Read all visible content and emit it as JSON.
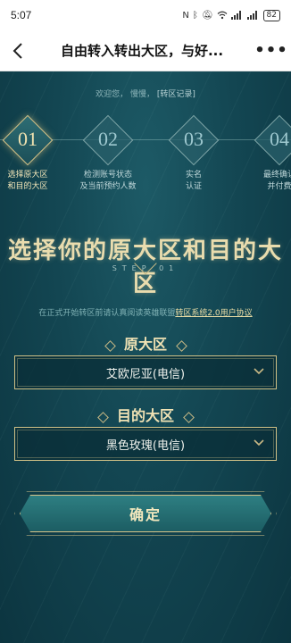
{
  "status_bar": {
    "time": "5:07",
    "icons": [
      "nfc-icon",
      "bluetooth-icon",
      "mute-icon",
      "wifi-icon",
      "signal-icon",
      "signal-icon"
    ],
    "battery": "82"
  },
  "nav": {
    "title": "自由转入转出大区，与好...",
    "more": "•••"
  },
  "welcome": {
    "greeting": "欢迎您，",
    "user": "慢慢，",
    "record_link": "[转区记录]"
  },
  "steps": [
    {
      "num": "01",
      "label_line1": "选择原大区",
      "label_line2": "和目的大区",
      "active": true
    },
    {
      "num": "02",
      "label_line1": "检测账号状态",
      "label_line2": "及当前预约人数",
      "active": false
    },
    {
      "num": "03",
      "label_line1": "实名",
      "label_line2": "认证",
      "active": false
    },
    {
      "num": "04",
      "label_line1": "最终确认",
      "label_line2": "并付费",
      "active": false
    }
  ],
  "main": {
    "title": "选择你的原大区和目的大区",
    "step_en": "STEP 01",
    "agreement_text": "在正式开始转区前请认真阅读英雄联盟",
    "agreement_link": "转区系统2.0用户协议",
    "source_label": "原大区",
    "source_value": "艾欧尼亚(电信)",
    "target_label": "目的大区",
    "target_value": "黑色玫瑰(电信)",
    "confirm_label": "确定"
  },
  "colors": {
    "accent_gold": "#e9dcae",
    "background_teal": "#134652",
    "button_teal": "#2e7f82"
  }
}
